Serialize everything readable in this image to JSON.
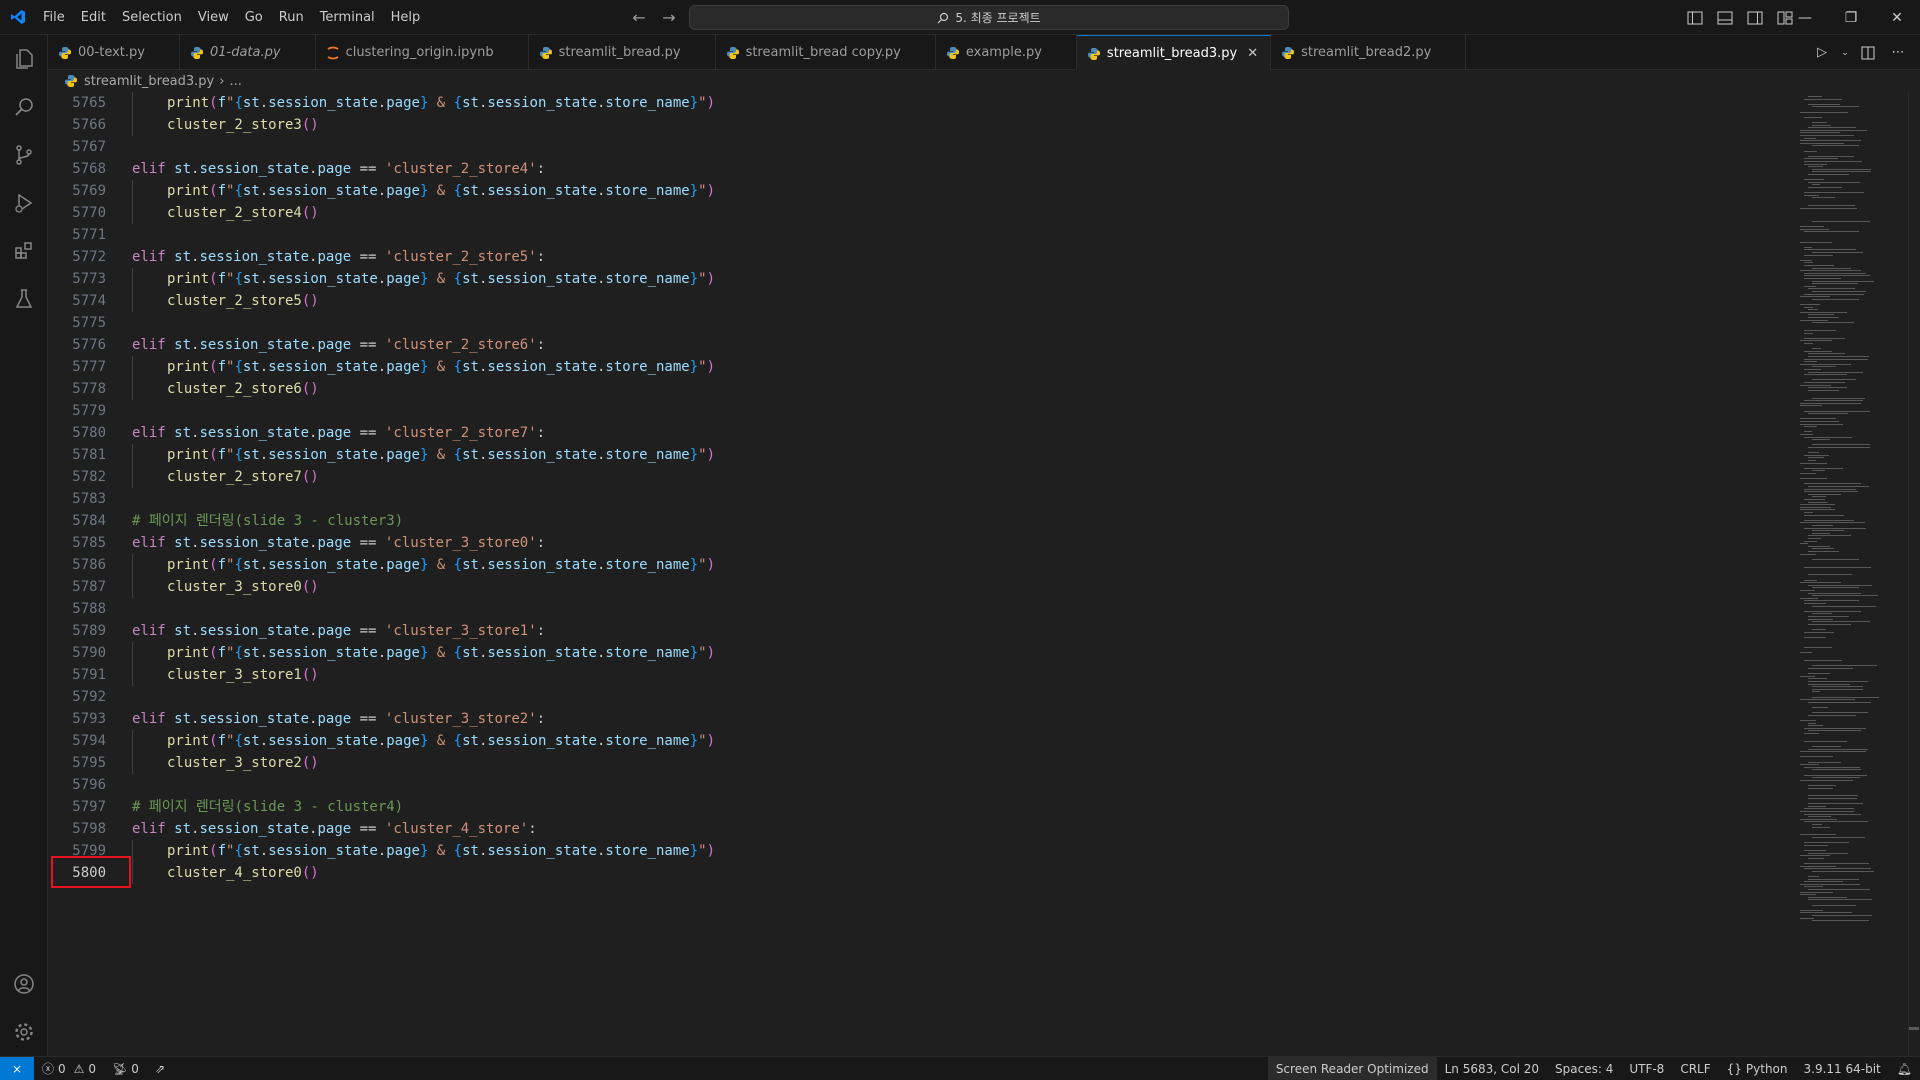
{
  "menu": [
    "File",
    "Edit",
    "Selection",
    "View",
    "Go",
    "Run",
    "Terminal",
    "Help"
  ],
  "command_center": {
    "text": "5. 최종 프로젝트"
  },
  "tabs": [
    {
      "label": "00-text.py",
      "italic": false,
      "active": false,
      "icon": "python-icon"
    },
    {
      "label": "01-data.py",
      "italic": true,
      "active": false,
      "icon": "python-icon"
    },
    {
      "label": "clustering_origin.ipynb",
      "italic": false,
      "active": false,
      "icon": "notebook-icon"
    },
    {
      "label": "streamlit_bread.py",
      "italic": false,
      "active": false,
      "icon": "python-icon"
    },
    {
      "label": "streamlit_bread copy.py",
      "italic": false,
      "active": false,
      "icon": "python-icon"
    },
    {
      "label": "example.py",
      "italic": false,
      "active": false,
      "icon": "python-icon"
    },
    {
      "label": "streamlit_bread3.py",
      "italic": false,
      "active": true,
      "icon": "python-icon"
    },
    {
      "label": "streamlit_bread2.py",
      "italic": false,
      "active": false,
      "icon": "python-icon"
    }
  ],
  "breadcrumb": {
    "file": "streamlit_bread3.py",
    "more": "..."
  },
  "code": {
    "lines": [
      {
        "n": "5765",
        "kind": "print"
      },
      {
        "n": "5766",
        "kind": "call",
        "name": "cluster_2_store3"
      },
      {
        "n": "5767",
        "kind": "blank"
      },
      {
        "n": "5768",
        "kind": "elif",
        "value": "cluster_2_store4"
      },
      {
        "n": "5769",
        "kind": "print"
      },
      {
        "n": "5770",
        "kind": "call",
        "name": "cluster_2_store4"
      },
      {
        "n": "5771",
        "kind": "blank"
      },
      {
        "n": "5772",
        "kind": "elif",
        "value": "cluster_2_store5"
      },
      {
        "n": "5773",
        "kind": "print"
      },
      {
        "n": "5774",
        "kind": "call",
        "name": "cluster_2_store5"
      },
      {
        "n": "5775",
        "kind": "blank"
      },
      {
        "n": "5776",
        "kind": "elif",
        "value": "cluster_2_store6"
      },
      {
        "n": "5777",
        "kind": "print"
      },
      {
        "n": "5778",
        "kind": "call",
        "name": "cluster_2_store6"
      },
      {
        "n": "5779",
        "kind": "blank"
      },
      {
        "n": "5780",
        "kind": "elif",
        "value": "cluster_2_store7"
      },
      {
        "n": "5781",
        "kind": "print"
      },
      {
        "n": "5782",
        "kind": "call",
        "name": "cluster_2_store7"
      },
      {
        "n": "5783",
        "kind": "blank"
      },
      {
        "n": "5784",
        "kind": "comment",
        "text": "# 페이지 렌더링(slide 3 - cluster3)"
      },
      {
        "n": "5785",
        "kind": "elif",
        "value": "cluster_3_store0"
      },
      {
        "n": "5786",
        "kind": "print"
      },
      {
        "n": "5787",
        "kind": "call",
        "name": "cluster_3_store0"
      },
      {
        "n": "5788",
        "kind": "blank"
      },
      {
        "n": "5789",
        "kind": "elif",
        "value": "cluster_3_store1"
      },
      {
        "n": "5790",
        "kind": "print"
      },
      {
        "n": "5791",
        "kind": "call",
        "name": "cluster_3_store1"
      },
      {
        "n": "5792",
        "kind": "blank"
      },
      {
        "n": "5793",
        "kind": "elif",
        "value": "cluster_3_store2"
      },
      {
        "n": "5794",
        "kind": "print"
      },
      {
        "n": "5795",
        "kind": "call",
        "name": "cluster_3_store2"
      },
      {
        "n": "5796",
        "kind": "blank"
      },
      {
        "n": "5797",
        "kind": "comment",
        "text": "# 페이지 렌더링(slide 3 - cluster4)"
      },
      {
        "n": "5798",
        "kind": "elif",
        "value": "cluster_4_store"
      },
      {
        "n": "5799",
        "kind": "print"
      },
      {
        "n": "5800",
        "kind": "call",
        "name": "cluster_4_store0"
      }
    ]
  },
  "status": {
    "errors": "0",
    "warnings": "0",
    "ports": "0",
    "screen_reader": "Screen Reader Optimized",
    "position": "Ln 5683, Col 20",
    "spaces": "Spaces: 4",
    "encoding": "UTF-8",
    "eol": "CRLF",
    "language": "Python",
    "interpreter": "3.9.11 64-bit"
  },
  "colors": {
    "accent": "#0078d4",
    "highlight_box": "#e81123"
  }
}
